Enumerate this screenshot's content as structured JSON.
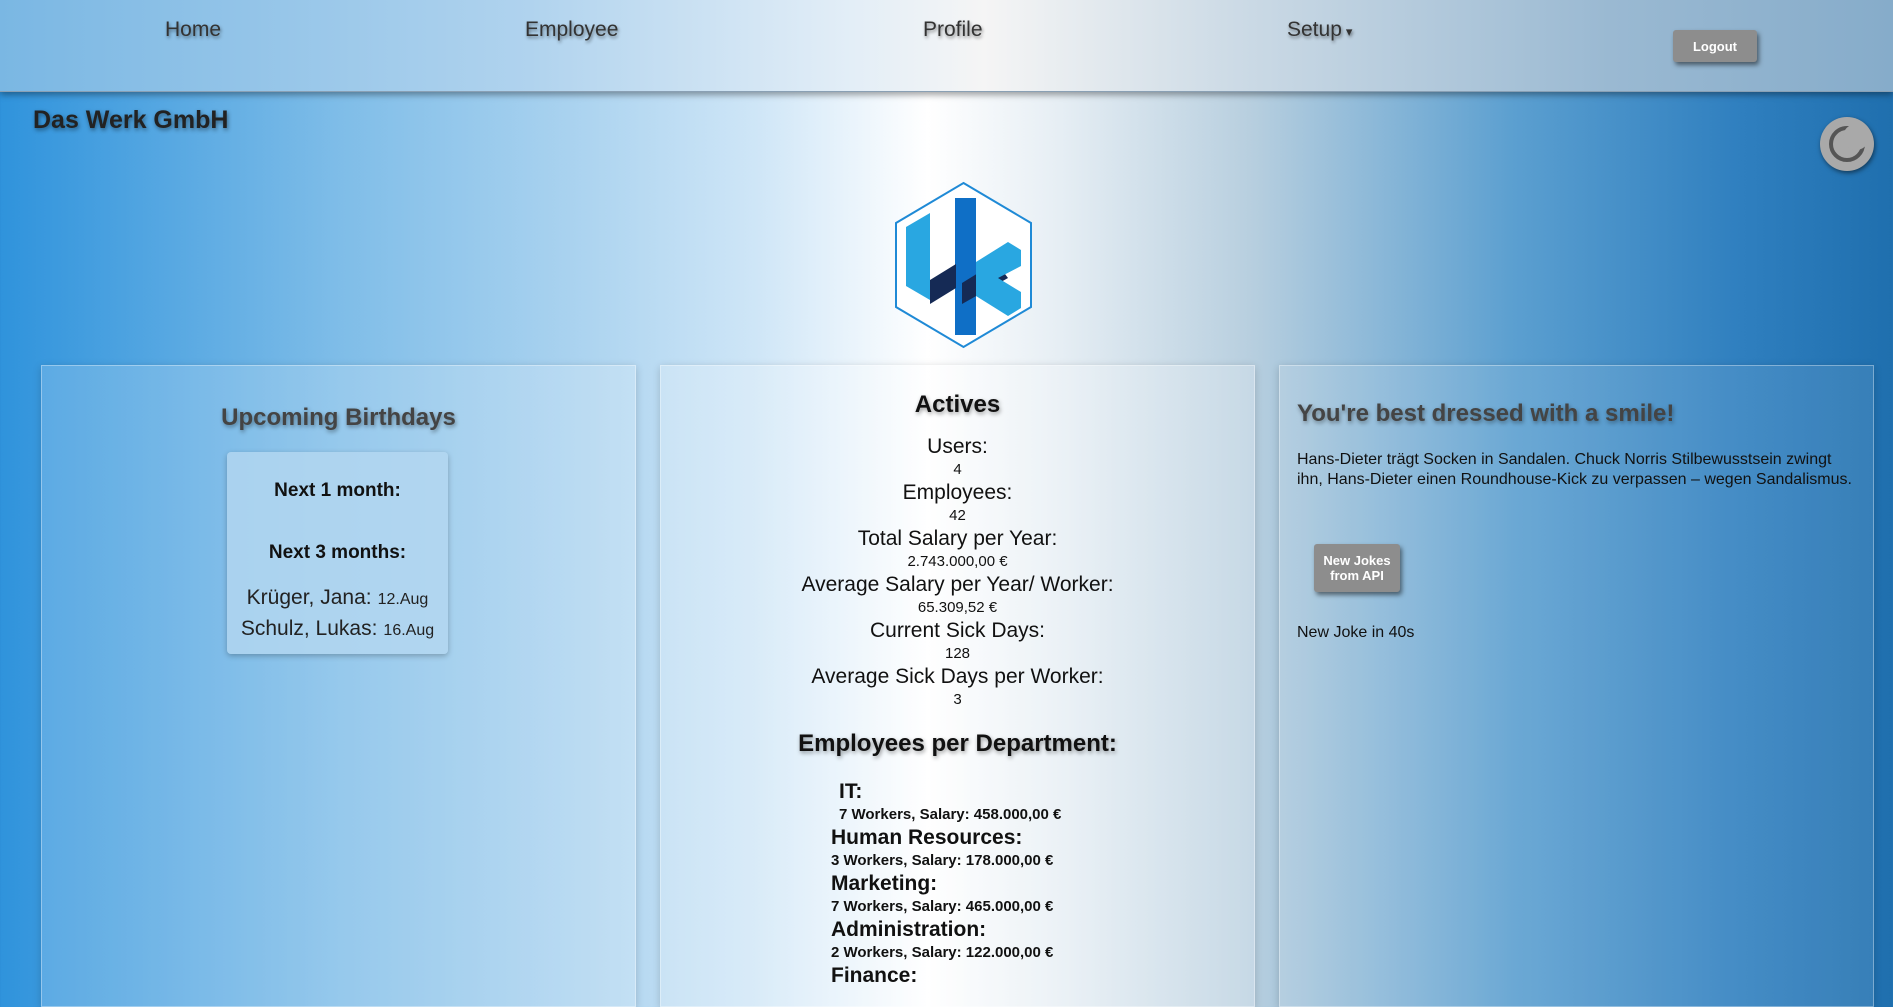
{
  "nav": {
    "items": [
      {
        "label": "Home"
      },
      {
        "label": "Employee"
      },
      {
        "label": "Profile"
      },
      {
        "label": "Setup"
      }
    ],
    "setup_caret": "▾",
    "logout_label": "Logout"
  },
  "company_name": "Das Werk GmbH",
  "theme_toggle_icon": "moon-icon",
  "birthdays": {
    "title": "Upcoming Birthdays",
    "next_1_month_label": "Next 1 month:",
    "next_3_months_label": "Next 3 months:",
    "entries": [
      {
        "name": "Krüger, Jana:",
        "date": "12.Aug"
      },
      {
        "name": "Schulz, Lukas:",
        "date": "16.Aug"
      }
    ]
  },
  "actives": {
    "title": "Actives",
    "stats": [
      {
        "label": "Users:",
        "value": "4"
      },
      {
        "label": "Employees:",
        "value": "42"
      },
      {
        "label": "Total Salary per Year:",
        "value": "2.743.000,00 €"
      },
      {
        "label": "Average Salary per Year/ Worker:",
        "value": "65.309,52 €"
      },
      {
        "label": "Current Sick Days:",
        "value": "128"
      },
      {
        "label": "Average Sick Days per Worker:",
        "value": "3"
      }
    ],
    "departments_title": "Employees per Department:",
    "departments": [
      {
        "name": "IT:",
        "detail": "7 Workers, Salary: 458.000,00 €"
      },
      {
        "name": "Human Resources:",
        "detail": "3 Workers, Salary: 178.000,00 €"
      },
      {
        "name": "Marketing:",
        "detail": "7 Workers, Salary: 465.000,00 €"
      },
      {
        "name": "Administration:",
        "detail": "2 Workers, Salary: 122.000,00 €"
      },
      {
        "name": "Finance:",
        "detail": ""
      }
    ]
  },
  "joke": {
    "title": "You're best dressed with a smile!",
    "text": "Hans-Dieter trägt Socken in Sandalen. Chuck Norris Stilbewusstsein zwingt ihn, Hans-Dieter einen Roundhouse-Kick zu verpassen – wegen Sandalismus.",
    "button_line1": "New Jokes",
    "button_line2": "from API",
    "countdown": "New Joke in 40s"
  },
  "colors": {
    "button_gray": "#8d8d8d",
    "logo_light_blue": "#29a7e1",
    "logo_mid_blue": "#0f6fc6",
    "logo_navy": "#152a55"
  }
}
